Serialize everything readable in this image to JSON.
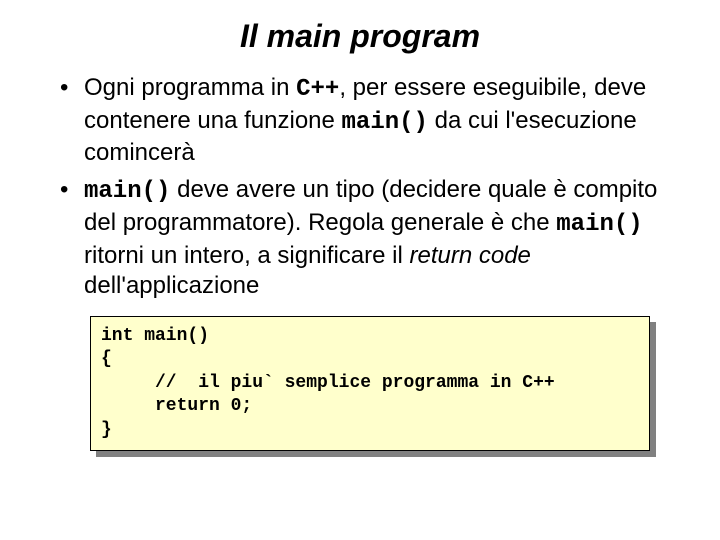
{
  "title": "Il main program",
  "bullets": [
    {
      "pre1": "Ogni programma in ",
      "code1": "C++",
      "mid1": ", per essere eseguibile, deve contenere una funzione ",
      "code2": "main()",
      "post1": " da cui l'esecuzione comincerà"
    },
    {
      "code1": "main()",
      "mid1": " deve avere un tipo (decidere quale è compito del programmatore). Regola generale è che ",
      "code2": "main()",
      "mid2": " ritorni un intero, a significare il ",
      "ital": "return code",
      "post1": " dell'applicazione"
    }
  ],
  "code": "int main()\n{\n     //  il piu` semplice programma in C++\n     return 0;\n}"
}
